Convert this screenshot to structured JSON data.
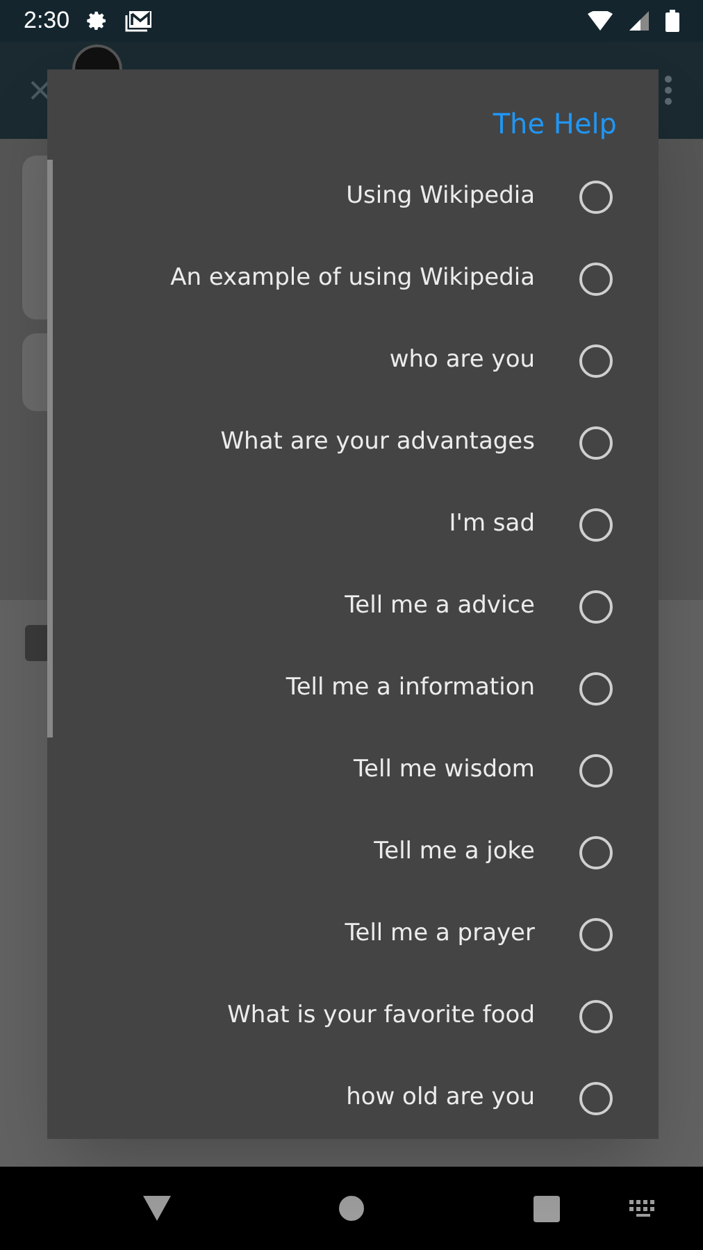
{
  "status_bar": {
    "time": "2:30"
  },
  "dialog": {
    "title": "The Help",
    "options": [
      {
        "label": "Using Wikipedia",
        "selected": false
      },
      {
        "label": "An example of using Wikipedia",
        "selected": false
      },
      {
        "label": "who are you",
        "selected": false
      },
      {
        "label": "What are your advantages",
        "selected": false
      },
      {
        "label": "I'm sad",
        "selected": false
      },
      {
        "label": "Tell me a advice",
        "selected": false
      },
      {
        "label": "Tell me a information",
        "selected": false
      },
      {
        "label": "Tell me wisdom",
        "selected": false
      },
      {
        "label": "Tell me a joke",
        "selected": false
      },
      {
        "label": "Tell me a prayer",
        "selected": false
      },
      {
        "label": "What is your favorite food",
        "selected": false
      },
      {
        "label": "how old are you",
        "selected": false
      }
    ]
  }
}
